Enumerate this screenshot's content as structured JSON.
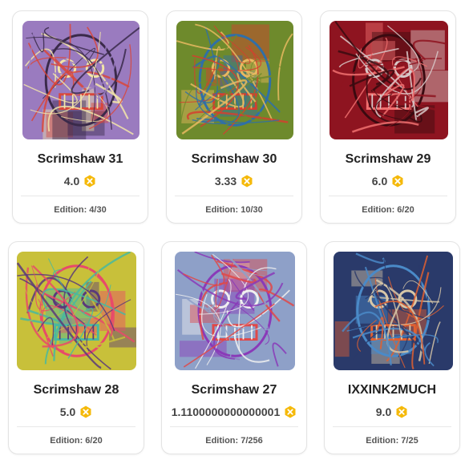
{
  "colors": {
    "coin": "#f5b90a",
    "coin_mark": "#ffffff",
    "title_text": "#222222",
    "border": "#e3e3e3"
  },
  "icons": {
    "price": "coin-icon"
  },
  "cards": [
    {
      "title": "Scrimshaw 31",
      "price": "4.0",
      "edition": "Edition: 4/30",
      "art_colors": [
        "#9a7bbf",
        "#f3e6a8",
        "#d9473a",
        "#3a2a4a"
      ]
    },
    {
      "title": "Scrimshaw 30",
      "price": "3.33",
      "edition": "Edition: 10/30",
      "art_colors": [
        "#6e8a2c",
        "#e8b860",
        "#d43f2f",
        "#2f6fa8"
      ]
    },
    {
      "title": "Scrimshaw 29",
      "price": "6.0",
      "edition": "Edition: 6/20",
      "art_colors": [
        "#8e1420",
        "#d8c8c8",
        "#f07070",
        "#3a0a10"
      ]
    },
    {
      "title": "Scrimshaw 28",
      "price": "5.0",
      "edition": "Edition: 6/20",
      "art_colors": [
        "#c8c03a",
        "#5a3a7a",
        "#48b8a0",
        "#e84a6a"
      ]
    },
    {
      "title": "Scrimshaw 27",
      "price": "1.1100000000000001",
      "edition": "Edition: 7/256",
      "art_colors": [
        "#8ea0c8",
        "#f0f0f0",
        "#e04848",
        "#8a3ab8"
      ]
    },
    {
      "title": "IXXINK2MUCH",
      "price": "9.0",
      "edition": "Edition: 7/25",
      "art_colors": [
        "#2a3a6a",
        "#d8c8a8",
        "#e06030",
        "#4a8ac8"
      ]
    }
  ]
}
